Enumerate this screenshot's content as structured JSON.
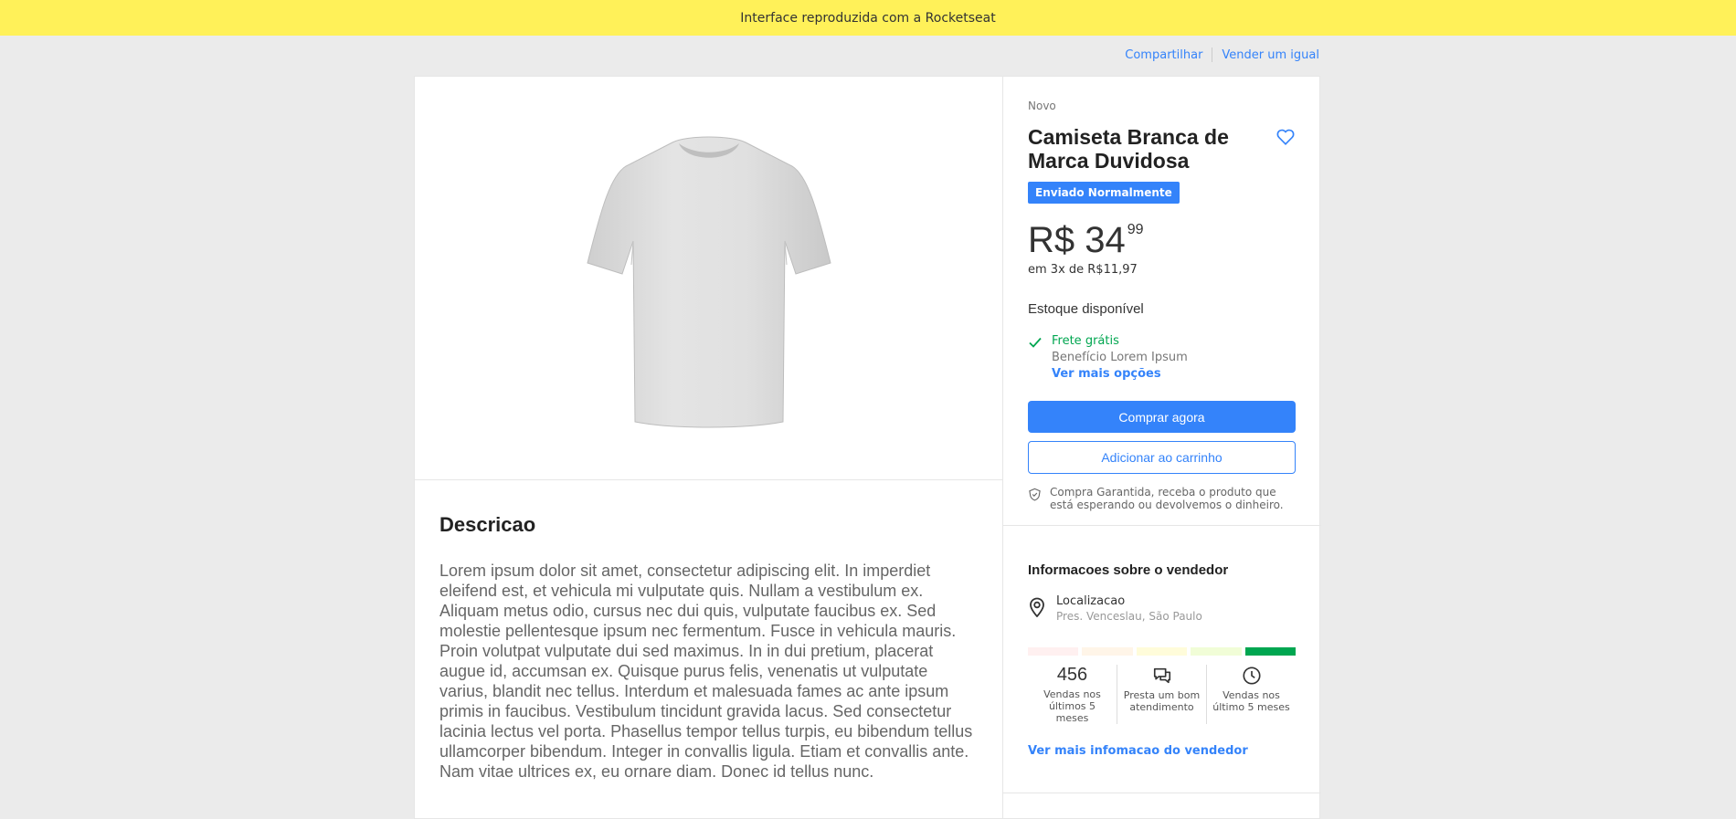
{
  "banner": {
    "text": "Interface reproduzida com a Rocketseat"
  },
  "top_links": {
    "share": "Compartilhar",
    "sell_same": "Vender um igual"
  },
  "product": {
    "image_icon": "tshirt-image",
    "condition": "Novo",
    "title": "Camiseta Branca de Marca Duvidosa",
    "badge": "Enviado Normalmente",
    "price_currency_int": "R$ 34",
    "price_cents": "99",
    "installments": "em 3x de R$11,97",
    "stock": "Estoque disponível",
    "shipping": {
      "free_label": "Frete grátis",
      "benefit": "Benefício Lorem Ipsum",
      "more_options": "Ver mais opções"
    },
    "buy_now": "Comprar agora",
    "add_to_cart": "Adicionar ao carrinho",
    "guarantee": "Compra Garantida, receba o produto que está esperando ou devolvemos o dinheiro."
  },
  "description": {
    "heading": "Descricao",
    "body": "Lorem ipsum dolor sit amet, consectetur adipiscing elit. In imperdiet eleifend est, et vehicula mi vulputate quis. Nullam a vestibulum ex. Aliquam metus odio, cursus nec dui quis, vulputate faucibus ex. Sed molestie pellentesque ipsum nec fermentum. Fusce in vehicula mauris. Proin volutpat vulputate dui sed maximus. In in dui pretium, placerat augue id, accumsan ex. Quisque purus felis, venenatis ut vulputate varius, blandit nec tellus. Interdum et malesuada fames ac ante ipsum primis in faucibus. Vestibulum tincidunt gravida lacus. Sed consectetur lacinia lectus vel porta. Phasellus tempor tellus turpis, eu bibendum tellus ullamcorper bibendum. Integer in convallis ligula. Etiam et convallis ante. Nam vitae ultrices ex, eu ornare diam. Donec id tellus nunc."
  },
  "seller": {
    "heading": "Informacoes sobre o vendedor",
    "location_label": "Localizacao",
    "location_value": "Pres. Venceslau, São Paulo",
    "reputation_colors": [
      "#fff0f0",
      "#fff5e8",
      "#fffcda",
      "#f1fdd7",
      "#00a650"
    ],
    "metrics": [
      {
        "value": "456",
        "label": "Vendas nos últimos 5 meses"
      },
      {
        "icon": "chat-icon",
        "label": "Presta um bom atendimento"
      },
      {
        "icon": "clock-icon",
        "label": "Vendas nos último 5 meses"
      }
    ],
    "more_link": "Ver mais infomacao do vendedor"
  },
  "colors": {
    "banner": "#fff159",
    "accent": "#3483fa",
    "success": "#00a650",
    "background": "#ebebeb"
  }
}
